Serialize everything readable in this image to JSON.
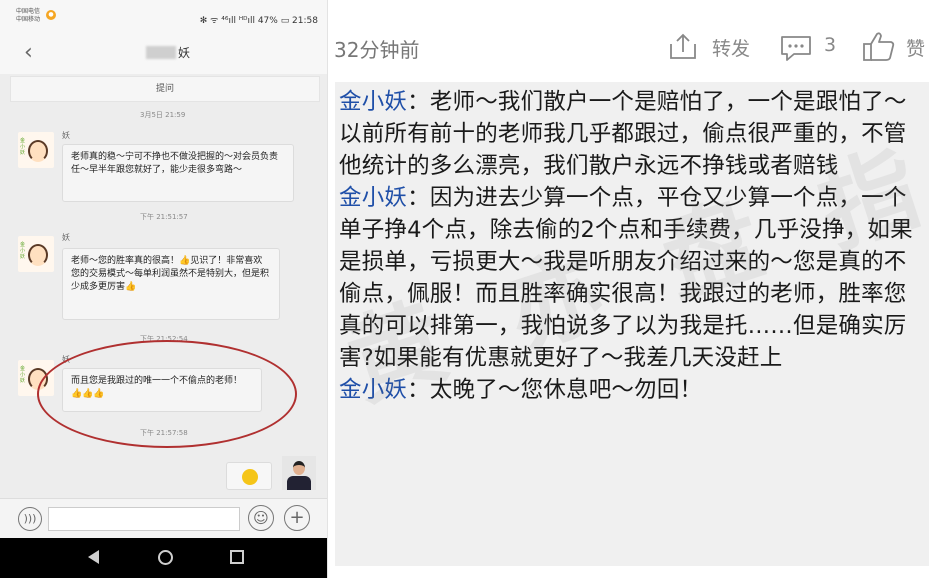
{
  "phone": {
    "status": {
      "carrier_line1": "中国电信",
      "carrier_line2": "中国移动",
      "right": "✻ ᯤ ⁴⁶ıll ᴴᴰıll 47% ▭ 21:58"
    },
    "nav": {
      "back_icon": "chevron-left-icon",
      "contact_name": "妖"
    },
    "tiwen_label": "提问",
    "messages": [
      {
        "timestamp": "3月5日  21:59",
        "name": "妖",
        "text": "老师真的稳～宁可不挣也不做没把握的～对会员负责任～早半年跟您就好了，能少走很多弯路～"
      },
      {
        "timestamp": "下午 21:51:57",
        "name": "妖",
        "text": "老师～您的胜率真的很高！👍见识了！非常喜欢您的交易模式～每单利润虽然不是特别大，但是积少成多更厉害👍"
      },
      {
        "timestamp": "下午 21:52:54",
        "name": "妖",
        "text": "而且您是我跟过的唯一一个不偷点的老师！👍👍👍"
      }
    ],
    "last_timestamp": "下午 21:57:58",
    "reply_emoji": "😊",
    "avatar_text": "金小妖"
  },
  "post": {
    "time": "32分钟前",
    "share_label": "转发",
    "comment_count": "3",
    "like_label": "赞",
    "paragraphs": [
      {
        "speaker": "金小妖",
        "sep": "：",
        "text": "老师～我们散户一个是赔怕了，一个是跟怕了～以前所有前十的老师我几乎都跟过，偷点很严重的，不管他统计的多么漂亮，我们散户永远不挣钱或者赔钱"
      },
      {
        "speaker": "金小妖",
        "sep": "：",
        "text": "因为进去少算一个点，平仓又少算一个点，一个单子挣4个点，除去偷的2个点和手续费，几乎没挣，如果是损单，亏损更大～我是听朋友介绍过来的～您是真的不偷点，佩服！而且胜率确实很高！我跟过的老师，胜率您真的可以排第一，我怕说多了以为我是托……但是确实厉害?如果能有优惠就更好了～我差几天没赶上"
      },
      {
        "speaker": "金小妖",
        "sep": "：",
        "text": "太晚了～您休息吧～勿回！"
      }
    ],
    "watermark": "黄 亦 盘 指 导"
  },
  "colors": {
    "speaker": "#1f4fa8",
    "highlight_oval": "#b03030"
  }
}
